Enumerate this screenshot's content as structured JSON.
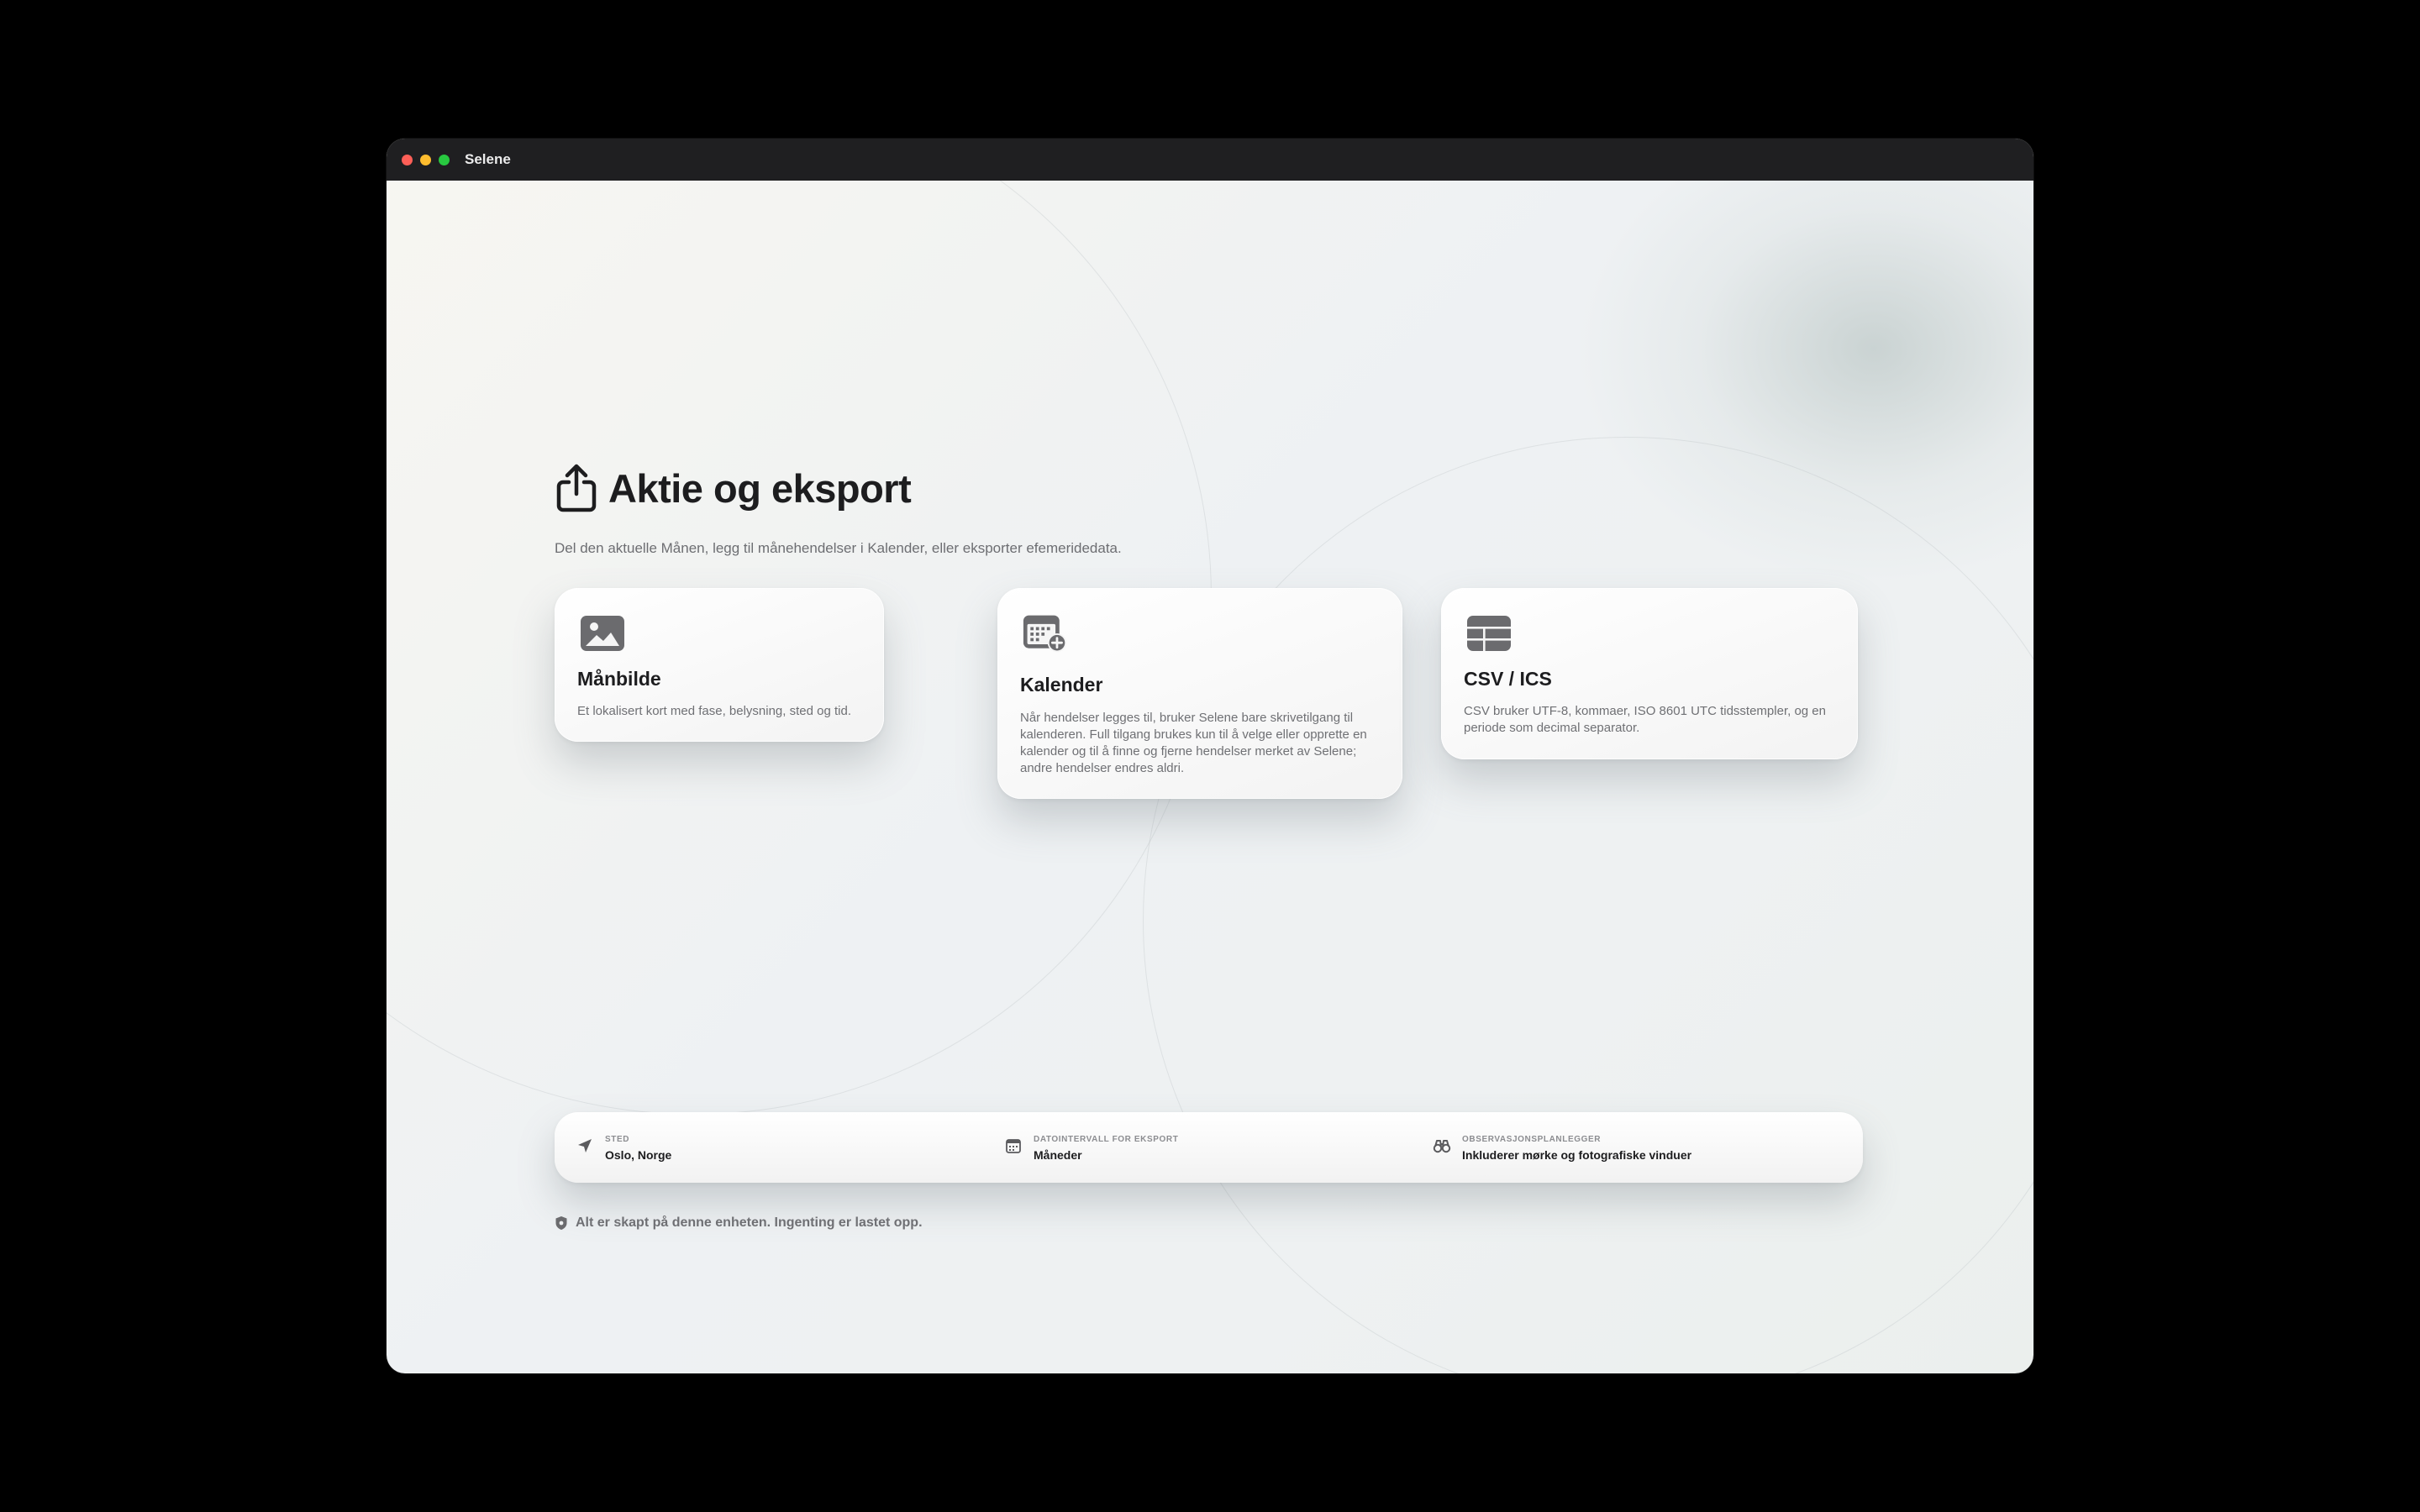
{
  "window": {
    "title": "Selene"
  },
  "page": {
    "title": "Aktie og eksport",
    "subtitle": "Del den aktuelle Månen, legg til månehendelser i Kalender, eller eksporter efemeridedata."
  },
  "cards": [
    {
      "icon": "photo-icon",
      "title": "Månbilde",
      "desc": "Et lokalisert kort med fase, belysning, sted og tid."
    },
    {
      "icon": "calendar-add-icon",
      "title": "Kalender",
      "desc": "Når hendelser legges til, bruker Selene bare skrivetilgang til kalenderen. Full tilgang brukes kun til å velge eller opprette en kalender og til å finne og fjerne hendelser merket av Selene; andre hendelser endres aldri."
    },
    {
      "icon": "table-icon",
      "title": "CSV / ICS",
      "desc": "CSV bruker UTF-8, kommaer, ISO 8601 UTC tidsstempler, og en periode som decimal separator."
    }
  ],
  "info": [
    {
      "icon": "location-arrow-icon",
      "label": "STED",
      "value": "Oslo, Norge"
    },
    {
      "icon": "calendar-icon",
      "label": "DATOINTERVALL FOR EKSPORT",
      "value": "Måneder"
    },
    {
      "icon": "binoculars-icon",
      "label": "OBSERVASJONSPLANLEGGER",
      "value": "Inkluderer mørke og fotografiske vinduer"
    }
  ],
  "privacy": {
    "icon": "shield-icon",
    "text": "Alt er skapt på denne enheten. Ingenting er lastet opp."
  },
  "colors": {
    "accent_icon": "#6b6b6e",
    "title_bar": "#1f1f21"
  }
}
